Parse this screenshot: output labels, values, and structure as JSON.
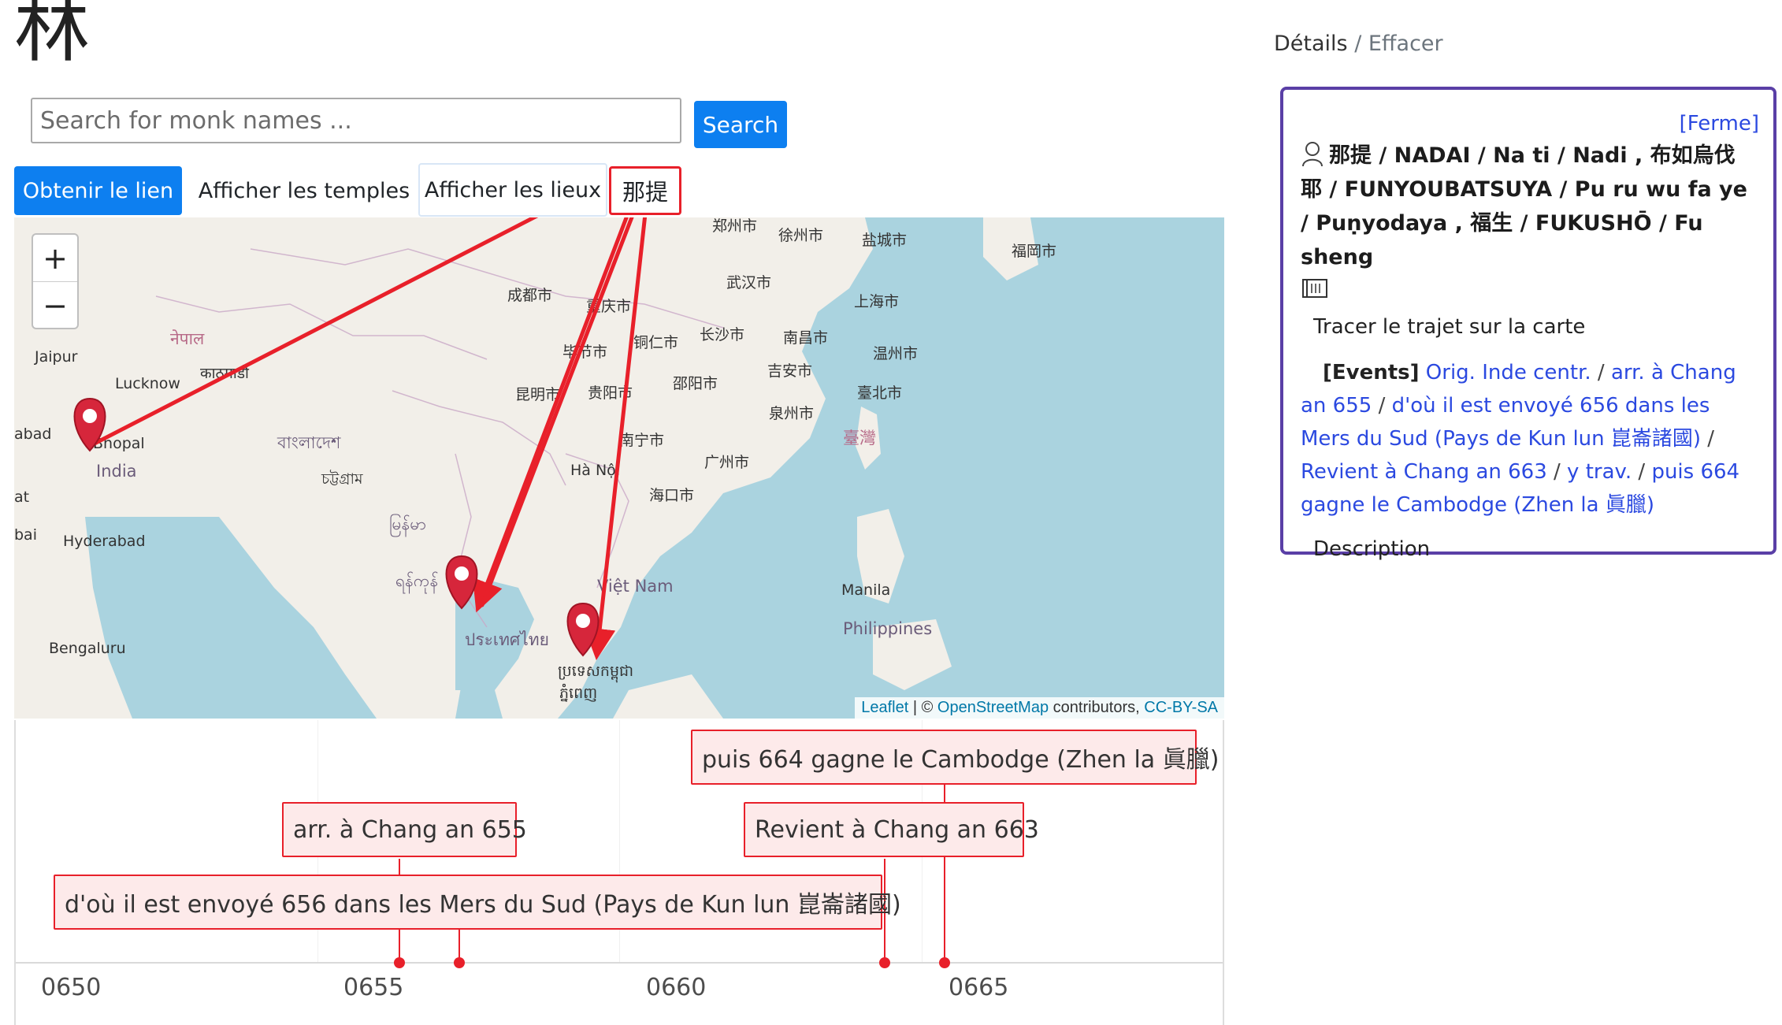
{
  "logo": {
    "text": "林"
  },
  "search": {
    "placeholder": "Search for monk names ...",
    "button_label": "Search"
  },
  "toolbar": {
    "get_link_label": "Obtenir le lien",
    "show_temples_label": "Afficher les temples",
    "show_places_label": "Afficher les lieux",
    "monk_label": "那提"
  },
  "map": {
    "zoom_in": "+",
    "zoom_out": "−",
    "labels": [
      "郑州市",
      "徐州市",
      "盐城市",
      "福岡市",
      "成都市",
      "重庆市",
      "武汉市",
      "上海市",
      "नेपाल",
      "काठमाडौं",
      "长沙市",
      "南昌市",
      "温州市",
      "毕节市",
      "铜仁市",
      "吉安市",
      "Jaipur",
      "Lucknow",
      "昆明市",
      "贵阳市",
      "邵阳市",
      "臺北市",
      "Bhopal",
      "India",
      "বাংলাদেশ",
      "南宁市",
      "泉州市",
      "臺灣",
      "abad",
      "চট্টগ্রাম",
      "Hà Nội",
      "广州市",
      "at",
      "海口市",
      "မြန်မာ",
      "Hyderabad",
      "bai",
      "ประเทศไทย",
      "ရန်ကုန်",
      "Việt Nam",
      "Manila",
      "Philippines",
      "Bengaluru",
      "ភ្នំពេញ",
      "ប្រទេសកម្ពុជា"
    ],
    "attribution": {
      "leaflet": "Leaflet",
      "sep": " | © ",
      "osm": "OpenStreetMap",
      "contrib": " contributors, ",
      "license": "CC-BY-SA"
    }
  },
  "timeline": {
    "ticks": [
      "0650",
      "0655",
      "0660",
      "0665"
    ],
    "events": [
      {
        "label": "puis 664 gagne le Cambodge (Zhen la 眞臘)"
      },
      {
        "label": "arr. à Chang an 655"
      },
      {
        "label": "Revient à Chang an 663"
      },
      {
        "label": "d'où il est envoyé 656 dans les Mers du Sud (Pays de Kun lun 崑崙諸國)"
      }
    ]
  },
  "details": {
    "breadcrumb_details": "Détails",
    "breadcrumb_sep": " / ",
    "breadcrumb_clear": "Effacer",
    "close_label": "[Ferme]",
    "monk_names": "那提 / NADAI / Na ti / Nadi , 布如烏伐耶 / FUNYOUBATSUYA / Pu ru wu fa ye / Puṇyodaya , 福生 / FUKUSHŌ / Fu sheng",
    "trace_label": "Tracer le trajet sur la carte",
    "events_tag": "[Events]",
    "event_links": [
      "Orig. Inde centr.",
      "arr. à Chang an 655",
      "d'où il est envoyé 656 dans les Mers du Sud (Pays de Kun lun 崑崙諸國)",
      "Revient à Chang an 663",
      "y trav.",
      "puis 664 gagne le Cambodge (Zhen la 眞臘)"
    ],
    "description_label": "Description"
  },
  "colors": {
    "accent": "#0d7ff0",
    "marker": "#d6263b",
    "route": "#e8202a",
    "card_border": "#5a3fa6",
    "link": "#2b49e0"
  }
}
